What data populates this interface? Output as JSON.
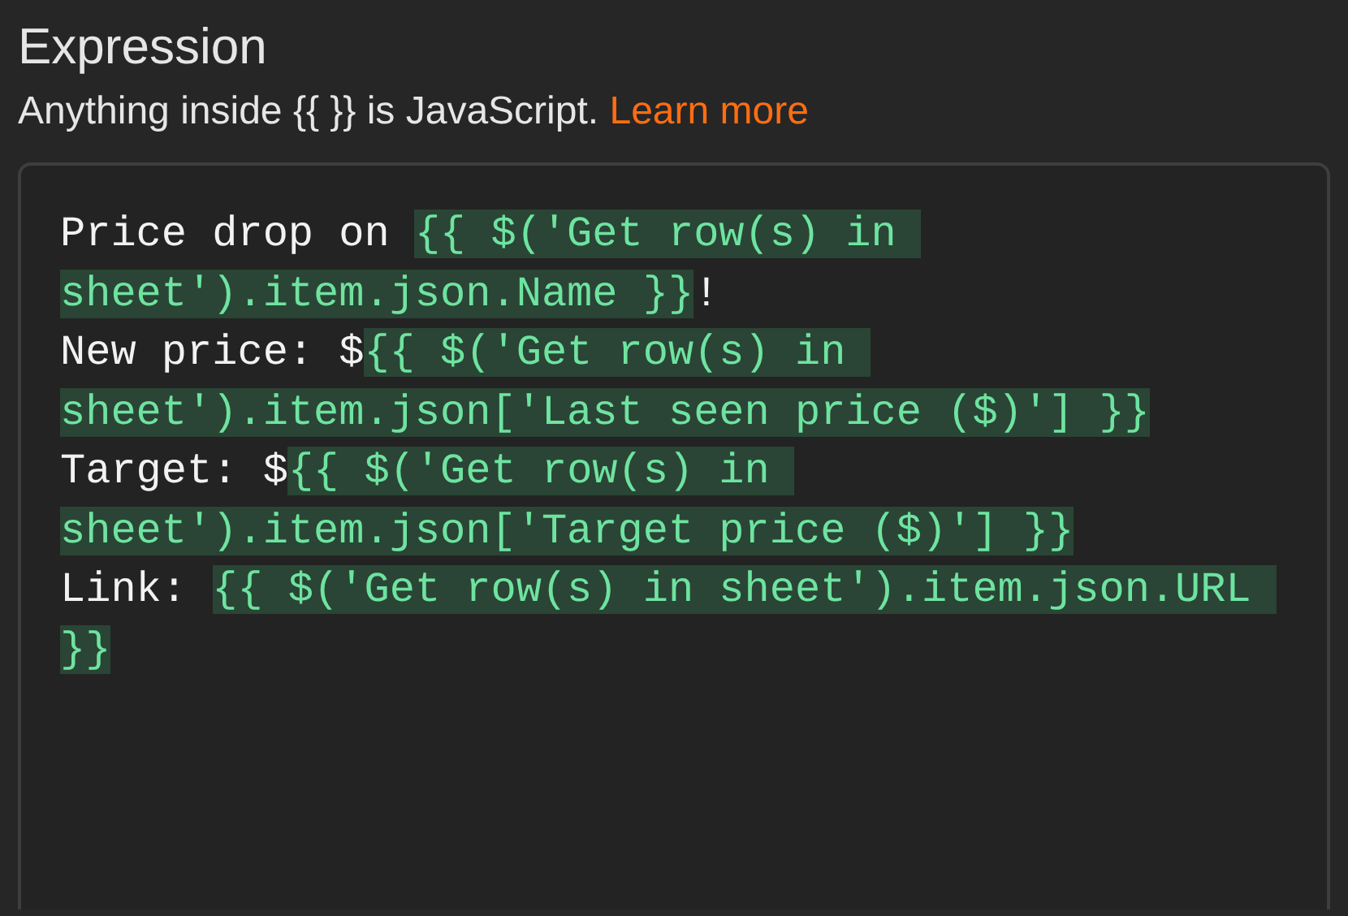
{
  "title": "Expression",
  "hint": {
    "text": "Anything inside {{ }} is JavaScript.",
    "link": "Learn more"
  },
  "editor": {
    "lines": [
      [
        {
          "kind": "text",
          "text": "Price drop on "
        },
        {
          "kind": "expression",
          "parts": [
            "{{ $('Get row(s) in",
            "sheet').item.json.Name }}"
          ]
        },
        {
          "kind": "text",
          "text": "!"
        }
      ],
      [
        {
          "kind": "text",
          "text": "New price: $"
        },
        {
          "kind": "expression",
          "parts": [
            "{{ $('Get row(s) in",
            "sheet').item.json['Last seen price ($)'] }}"
          ]
        }
      ],
      [
        {
          "kind": "text",
          "text": "Target: $"
        },
        {
          "kind": "expression",
          "parts": [
            "{{ $('Get row(s) in",
            "sheet').item.json['Target price ($)'] }}"
          ]
        }
      ],
      [
        {
          "kind": "text",
          "text": "Link: "
        },
        {
          "kind": "expression",
          "parts": [
            "{{ $('Get row(s) in sheet').item.json.URL",
            "}}"
          ]
        }
      ]
    ]
  }
}
